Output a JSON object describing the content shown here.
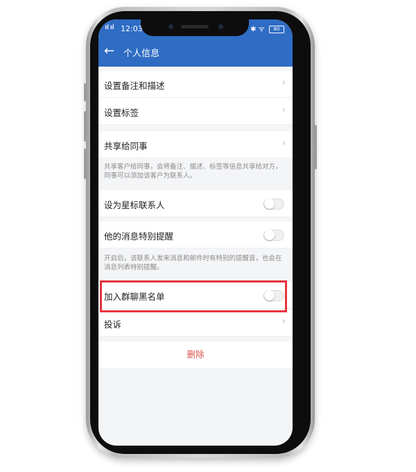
{
  "status_bar": {
    "signal": "ııl ııl",
    "time": "12:03",
    "right_icons": "✱ ᯤ",
    "battery": "80"
  },
  "app_bar": {
    "title": "个人信息"
  },
  "settings": {
    "notes": "设置备注和描述",
    "tags": "设置标签",
    "share": "共享给同事",
    "share_note": "共享客户给同事，会将备注、描述、标签等信息共享给对方，同事可以添加该客户为联系人。",
    "star_contact": "设为星标联系人",
    "special_reminder": "他的消息特别提醒",
    "reminder_note": "开启后，该联系人发来消息和邮件时有特别的提醒音，也会在消息列表特别提醒。",
    "blacklist": "加入群聊黑名单",
    "complain": "投诉",
    "delete": "删除"
  },
  "toggles": {
    "star_contact_on": false,
    "special_reminder_on": false,
    "blacklist_on": false
  },
  "colors": {
    "header_blue": "#2f6cc4",
    "delete_red": "#d9534f",
    "highlight_red": "#e8343c"
  }
}
